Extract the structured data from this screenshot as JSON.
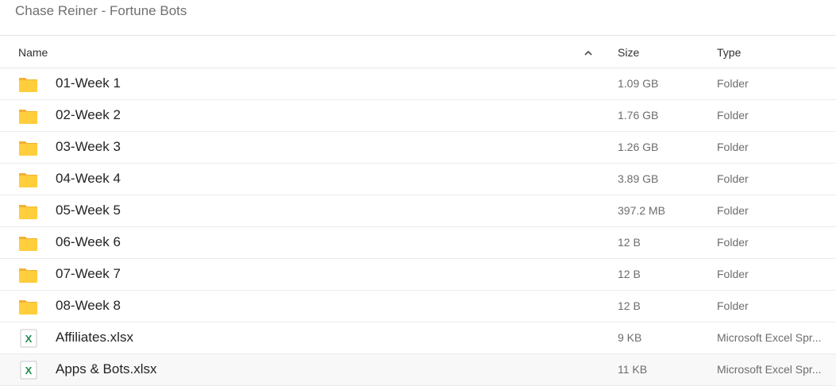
{
  "breadcrumb": {
    "title": "Chase Reiner - Fortune Bots"
  },
  "columns": {
    "name": "Name",
    "size": "Size",
    "type": "Type",
    "sort_icon": "chevron-up-icon"
  },
  "files": [
    {
      "name": "01-Week 1",
      "size": "1.09 GB",
      "type": "Folder",
      "icon": "folder-icon"
    },
    {
      "name": "02-Week 2",
      "size": "1.76 GB",
      "type": "Folder",
      "icon": "folder-icon"
    },
    {
      "name": "03-Week 3",
      "size": "1.26 GB",
      "type": "Folder",
      "icon": "folder-icon"
    },
    {
      "name": "04-Week 4",
      "size": "3.89 GB",
      "type": "Folder",
      "icon": "folder-icon"
    },
    {
      "name": "05-Week 5",
      "size": "397.2 MB",
      "type": "Folder",
      "icon": "folder-icon"
    },
    {
      "name": "06-Week 6",
      "size": "12 B",
      "type": "Folder",
      "icon": "folder-icon"
    },
    {
      "name": "07-Week 7",
      "size": "12 B",
      "type": "Folder",
      "icon": "folder-icon"
    },
    {
      "name": "08-Week 8",
      "size": "12 B",
      "type": "Folder",
      "icon": "folder-icon"
    },
    {
      "name": "Affiliates.xlsx",
      "size": "9 KB",
      "type": "Microsoft Excel Spr...",
      "icon": "excel-icon"
    },
    {
      "name": "Apps & Bots.xlsx",
      "size": "11 KB",
      "type": "Microsoft Excel Spr...",
      "icon": "excel-icon"
    }
  ],
  "colors": {
    "folder": "#FFCE3D",
    "folder_back": "#F2B134",
    "excel": "#1E8E4E"
  }
}
